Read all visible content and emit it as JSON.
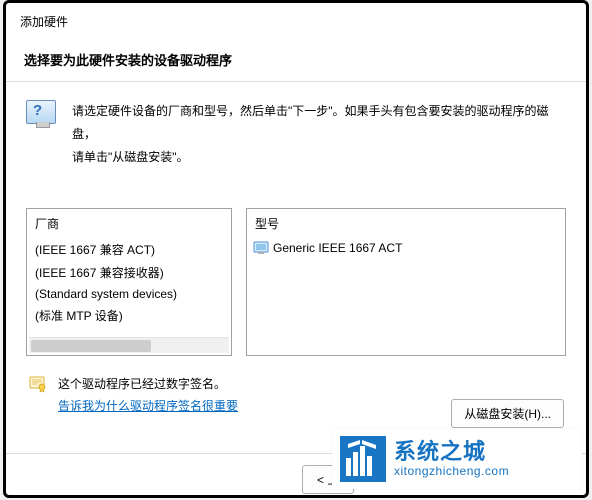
{
  "header": {
    "title": "添加硬件",
    "subtitle": "选择要为此硬件安装的设备驱动程序"
  },
  "info": {
    "line1": "请选定硬件设备的厂商和型号，然后单击\"下一步\"。如果手头有包含要安装的驱动程序的磁盘，",
    "line2": "请单击\"从磁盘安装\"。"
  },
  "lists": {
    "vendor_header": "厂商",
    "vendors": [
      "(IEEE 1667 兼容 ACT)",
      "(IEEE 1667 兼容接收器)",
      "(Standard system devices)",
      "(标准 MTP 设备)"
    ],
    "model_header": "型号",
    "models": [
      "Generic IEEE 1667 ACT"
    ]
  },
  "signature": {
    "signed_text": "这个驱动程序已经过数字签名。",
    "link_text": "告诉我为什么驱动程序签名很重要"
  },
  "buttons": {
    "install_from_disk": "从磁盘安装(H)...",
    "previous": "< 上"
  },
  "watermark": {
    "title": "系统之城",
    "url": "xitongzhicheng.com"
  }
}
